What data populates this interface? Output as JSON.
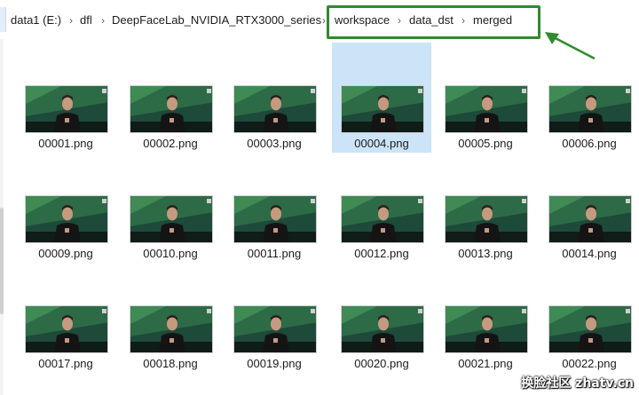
{
  "breadcrumb": [
    "data1 (E:)",
    "dfl",
    "DeepFaceLab_NVIDIA_RTX3000_series",
    "workspace",
    "data_dst",
    "merged"
  ],
  "breadcrumb_separator": "›",
  "files": [
    {
      "name": "00001.png",
      "selected": false
    },
    {
      "name": "00002.png",
      "selected": false
    },
    {
      "name": "00003.png",
      "selected": false
    },
    {
      "name": "00004.png",
      "selected": true
    },
    {
      "name": "00005.png",
      "selected": false
    },
    {
      "name": "00006.png",
      "selected": false
    },
    {
      "name": "00009.png",
      "selected": false
    },
    {
      "name": "00010.png",
      "selected": false
    },
    {
      "name": "00011.png",
      "selected": false
    },
    {
      "name": "00012.png",
      "selected": false
    },
    {
      "name": "00013.png",
      "selected": false
    },
    {
      "name": "00014.png",
      "selected": false
    },
    {
      "name": "00017.png",
      "selected": false
    },
    {
      "name": "00018.png",
      "selected": false
    },
    {
      "name": "00019.png",
      "selected": false
    },
    {
      "name": "00020.png",
      "selected": false
    },
    {
      "name": "00021.png",
      "selected": false
    },
    {
      "name": "00022.png",
      "selected": false
    }
  ],
  "annotation": {
    "color": "#2e8b2e",
    "shape": "rectangle-with-arrow",
    "target": "workspace › data_dst › merged"
  },
  "watermark": "换脸社区 zhatv.cn",
  "colors": {
    "selection": "#cce4f7",
    "annotation": "#2e8b2e"
  }
}
